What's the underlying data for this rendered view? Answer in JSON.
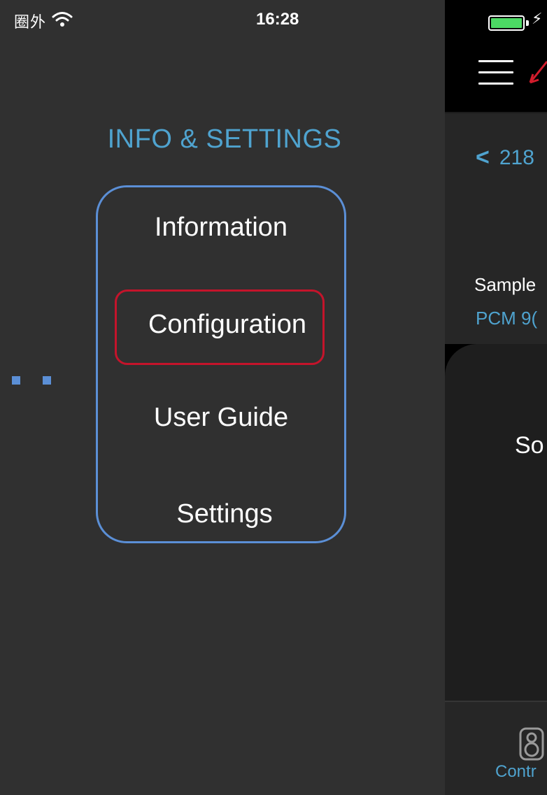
{
  "status_bar": {
    "carrier": "圈外",
    "time": "16:28"
  },
  "drawer": {
    "title": "INFO & SETTINGS",
    "items": [
      {
        "label": "Information"
      },
      {
        "label": "Configuration"
      },
      {
        "label": "User Guide"
      },
      {
        "label": "Settings"
      }
    ],
    "highlighted_item": "Configuration"
  },
  "main": {
    "back_text": "218",
    "sample_label": "Sample",
    "sample_value": "PCM 9(",
    "source_text": "So",
    "tab_label": "Contr"
  },
  "colors": {
    "accent": "#4fa3cf",
    "annotation_blue": "#5b8fd6",
    "annotation_red": "#c4142b",
    "battery_green": "#4cd964"
  },
  "icons": [
    "wifi-icon",
    "battery-icon",
    "charging-bolt-icon",
    "hamburger-menu-icon",
    "back-chevron-icon",
    "speaker-icon",
    "annotation-arrow-icon"
  ]
}
